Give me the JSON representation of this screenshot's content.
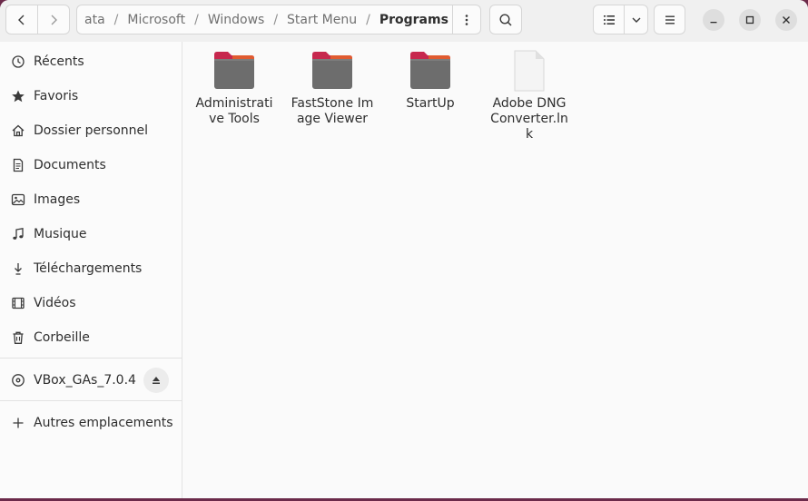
{
  "breadcrumb": {
    "items": [
      "ata",
      "Microsoft",
      "Windows",
      "Start Menu"
    ],
    "current": "Programs"
  },
  "sidebar": {
    "places": [
      {
        "label": "Récents",
        "icon": "clock-icon"
      },
      {
        "label": "Favoris",
        "icon": "star-icon"
      },
      {
        "label": "Dossier personnel",
        "icon": "home-icon"
      },
      {
        "label": "Documents",
        "icon": "document-icon"
      },
      {
        "label": "Images",
        "icon": "image-icon"
      },
      {
        "label": "Musique",
        "icon": "music-icon"
      },
      {
        "label": "Téléchargements",
        "icon": "download-icon"
      },
      {
        "label": "Vidéos",
        "icon": "video-icon"
      },
      {
        "label": "Corbeille",
        "icon": "trash-icon"
      }
    ],
    "device": {
      "label": "VBox_GAs_7.0.4",
      "icon": "disc-icon"
    },
    "other": {
      "label": "Autres emplacements",
      "icon": "plus-icon"
    }
  },
  "files": [
    {
      "name": "Administrative Tools",
      "type": "folder"
    },
    {
      "name": "FastStone Image Viewer",
      "type": "folder"
    },
    {
      "name": "StartUp",
      "type": "folder"
    },
    {
      "name": "Adobe DNG Converter.lnk",
      "type": "file"
    }
  ],
  "colors": {
    "folder_body": "#6d6d6d",
    "folder_tab_accent": "#c7284e",
    "folder_tab_orange": "#e2612d",
    "desktop_bg": "#6b2a4a"
  }
}
